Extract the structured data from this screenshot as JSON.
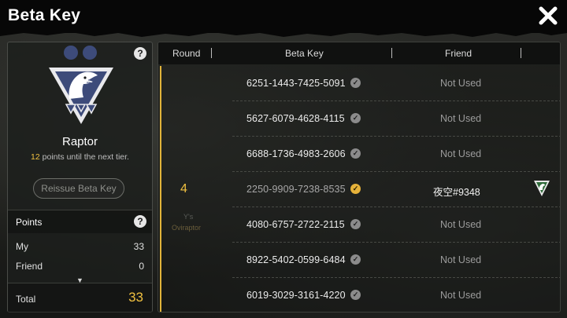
{
  "header": {
    "title": "Beta Key"
  },
  "tier": {
    "name": "Raptor",
    "points_needed": "12",
    "note_suffix": " points until the next tier.",
    "reissue_label": "Reissue Beta Key"
  },
  "points": {
    "heading": "Points",
    "rows": [
      {
        "label": "My",
        "value": "33"
      },
      {
        "label": "Friend",
        "value": "0"
      }
    ],
    "total_label": "Total",
    "total_value": "33"
  },
  "table": {
    "columns": [
      "Round",
      "Beta Key",
      "Friend"
    ],
    "round": "4",
    "round_ghost_1": "Y's",
    "round_ghost_2": "Oviraptor",
    "rows": [
      {
        "key": "6251-1443-7425-5091",
        "friend": "Not Used",
        "used": false
      },
      {
        "key": "5627-6079-4628-4115",
        "friend": "Not Used",
        "used": false
      },
      {
        "key": "6688-1736-4983-2606",
        "friend": "Not Used",
        "used": false
      },
      {
        "key": "2250-9909-7238-8535",
        "friend": "夜空#9348",
        "used": true
      },
      {
        "key": "4080-6757-2722-2115",
        "friend": "Not Used",
        "used": false
      },
      {
        "key": "8922-5402-0599-6484",
        "friend": "Not Used",
        "used": false
      },
      {
        "key": "6019-3029-3161-4220",
        "friend": "Not Used",
        "used": false
      }
    ]
  },
  "colors": {
    "accent": "#f0c040",
    "emblem": "#3d4b7a"
  },
  "icons": {
    "close": "close-icon",
    "help": "question-icon",
    "check": "check-circle-icon"
  }
}
